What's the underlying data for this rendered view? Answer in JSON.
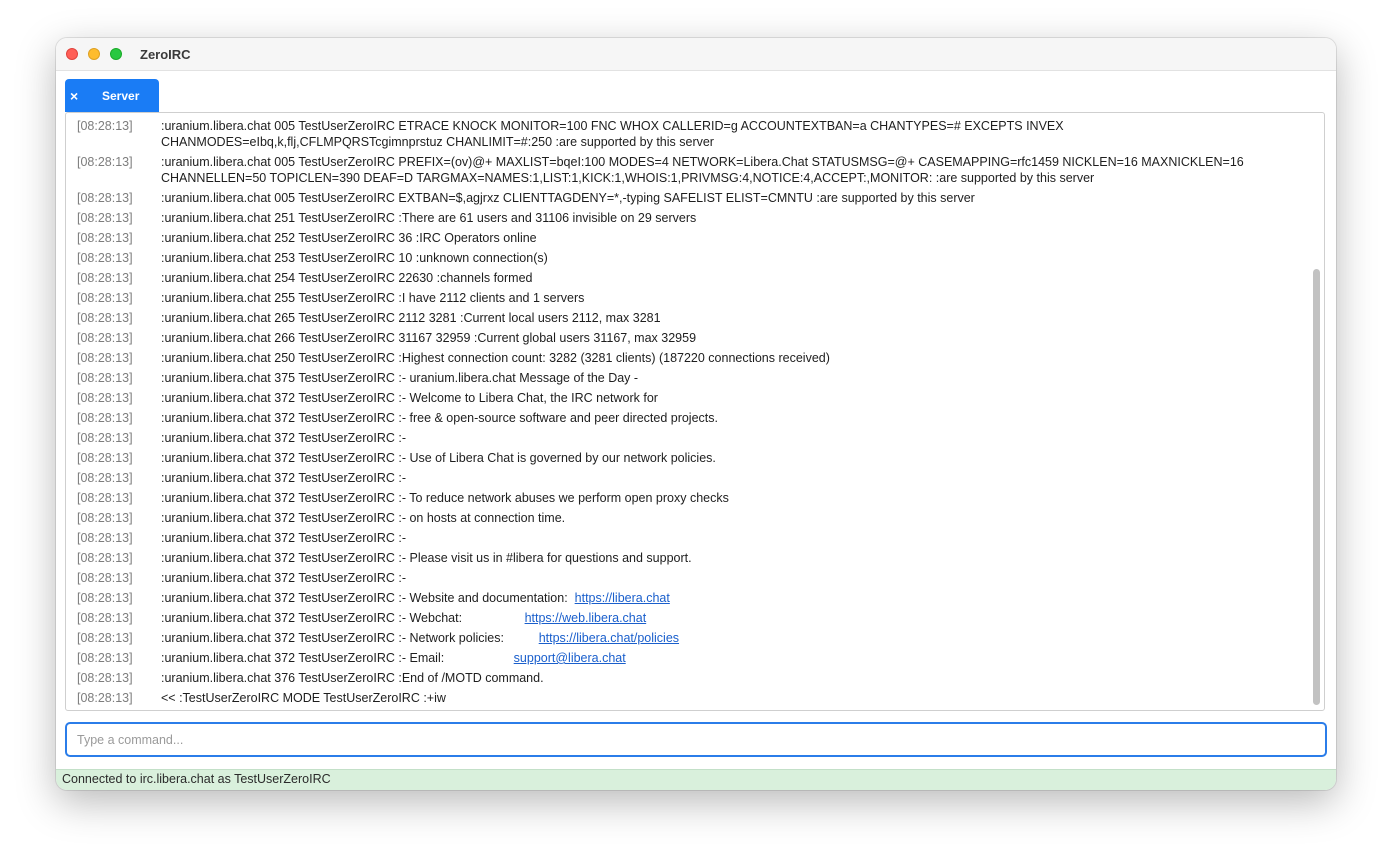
{
  "window": {
    "title": "ZeroIRC"
  },
  "tabs": [
    {
      "label": "Server",
      "close_glyph": "×",
      "active": true
    }
  ],
  "log": {
    "lines": [
      {
        "time": "[08:28:13]",
        "text": ":uranium.libera.chat 005 TestUserZeroIRC ETRACE KNOCK MONITOR=100 FNC WHOX CALLERID=g ACCOUNTEXTBAN=a CHANTYPES=# EXCEPTS INVEX CHANMODES=eIbq,k,flj,CFLMPQRSTcgimnprstuz CHANLIMIT=#:250 :are supported by this server"
      },
      {
        "time": "[08:28:13]",
        "text": ":uranium.libera.chat 005 TestUserZeroIRC PREFIX=(ov)@+ MAXLIST=bqeI:100 MODES=4 NETWORK=Libera.Chat STATUSMSG=@+ CASEMAPPING=rfc1459 NICKLEN=16 MAXNICKLEN=16 CHANNELLEN=50 TOPICLEN=390 DEAF=D TARGMAX=NAMES:1,LIST:1,KICK:1,WHOIS:1,PRIVMSG:4,NOTICE:4,ACCEPT:,MONITOR: :are supported by this server"
      },
      {
        "time": "[08:28:13]",
        "text": ":uranium.libera.chat 005 TestUserZeroIRC EXTBAN=$,agjrxz CLIENTTAGDENY=*,-typing SAFELIST ELIST=CMNTU :are supported by this server"
      },
      {
        "time": "[08:28:13]",
        "text": ":uranium.libera.chat 251 TestUserZeroIRC :There are 61 users and 31106 invisible on 29 servers"
      },
      {
        "time": "[08:28:13]",
        "text": ":uranium.libera.chat 252 TestUserZeroIRC 36 :IRC Operators online"
      },
      {
        "time": "[08:28:13]",
        "text": ":uranium.libera.chat 253 TestUserZeroIRC 10 :unknown connection(s)"
      },
      {
        "time": "[08:28:13]",
        "text": ":uranium.libera.chat 254 TestUserZeroIRC 22630 :channels formed"
      },
      {
        "time": "[08:28:13]",
        "text": ":uranium.libera.chat 255 TestUserZeroIRC :I have 2112 clients and 1 servers"
      },
      {
        "time": "[08:28:13]",
        "text": ":uranium.libera.chat 265 TestUserZeroIRC 2112 3281 :Current local users 2112, max 3281"
      },
      {
        "time": "[08:28:13]",
        "text": ":uranium.libera.chat 266 TestUserZeroIRC 31167 32959 :Current global users 31167, max 32959"
      },
      {
        "time": "[08:28:13]",
        "text": ":uranium.libera.chat 250 TestUserZeroIRC :Highest connection count: 3282 (3281 clients) (187220 connections received)"
      },
      {
        "time": "[08:28:13]",
        "text": ":uranium.libera.chat 375 TestUserZeroIRC :- uranium.libera.chat Message of the Day -"
      },
      {
        "time": "[08:28:13]",
        "text": ":uranium.libera.chat 372 TestUserZeroIRC :- Welcome to Libera Chat, the IRC network for"
      },
      {
        "time": "[08:28:13]",
        "text": ":uranium.libera.chat 372 TestUserZeroIRC :- free & open-source software and peer directed projects."
      },
      {
        "time": "[08:28:13]",
        "text": ":uranium.libera.chat 372 TestUserZeroIRC :-"
      },
      {
        "time": "[08:28:13]",
        "text": ":uranium.libera.chat 372 TestUserZeroIRC :- Use of Libera Chat is governed by our network policies."
      },
      {
        "time": "[08:28:13]",
        "text": ":uranium.libera.chat 372 TestUserZeroIRC :-"
      },
      {
        "time": "[08:28:13]",
        "text": ":uranium.libera.chat 372 TestUserZeroIRC :- To reduce network abuses we perform open proxy checks"
      },
      {
        "time": "[08:28:13]",
        "text": ":uranium.libera.chat 372 TestUserZeroIRC :- on hosts at connection time."
      },
      {
        "time": "[08:28:13]",
        "text": ":uranium.libera.chat 372 TestUserZeroIRC :-"
      },
      {
        "time": "[08:28:13]",
        "text": ":uranium.libera.chat 372 TestUserZeroIRC :- Please visit us in #libera for questions and support."
      },
      {
        "time": "[08:28:13]",
        "text": ":uranium.libera.chat 372 TestUserZeroIRC :-"
      },
      {
        "time": "[08:28:13]",
        "text": ":uranium.libera.chat 372 TestUserZeroIRC :- Website and documentation:  ",
        "link": "https://libera.chat"
      },
      {
        "time": "[08:28:13]",
        "text": ":uranium.libera.chat 372 TestUserZeroIRC :- Webchat:                  ",
        "link": "https://web.libera.chat"
      },
      {
        "time": "[08:28:13]",
        "text": ":uranium.libera.chat 372 TestUserZeroIRC :- Network policies:          ",
        "link": "https://libera.chat/policies"
      },
      {
        "time": "[08:28:13]",
        "text": ":uranium.libera.chat 372 TestUserZeroIRC :- Email:                    ",
        "link": "support@libera.chat"
      },
      {
        "time": "[08:28:13]",
        "text": ":uranium.libera.chat 376 TestUserZeroIRC :End of /MOTD command."
      },
      {
        "time": "[08:28:13]",
        "text": "<< :TestUserZeroIRC MODE TestUserZeroIRC :+iw"
      }
    ]
  },
  "command_input": {
    "value": "",
    "placeholder": "Type a command..."
  },
  "status_bar": {
    "text": "Connected to irc.libera.chat as TestUserZeroIRC"
  },
  "colors": {
    "tab_active": "#1a7cf5",
    "input_focus": "#2b7de9",
    "link": "#1a5fcc",
    "status_bg": "#d9f0dc",
    "timestamp": "#7d7d7d"
  },
  "icons": {
    "close_window": "close-traffic-light",
    "minimize_window": "minimize-traffic-light",
    "maximize_window": "maximize-traffic-light",
    "tab_close": "close-icon"
  }
}
